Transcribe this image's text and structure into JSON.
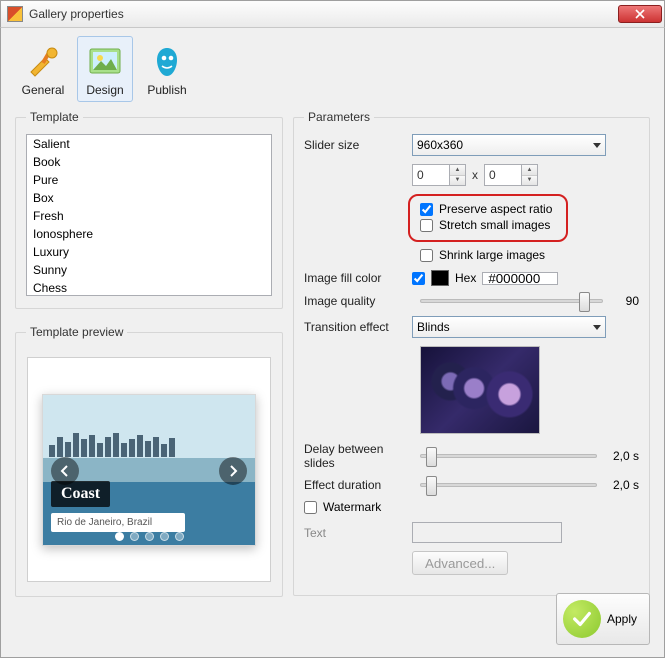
{
  "window": {
    "title": "Gallery properties"
  },
  "toolbar": {
    "general": "General",
    "design": "Design",
    "publish": "Publish"
  },
  "template": {
    "legend": "Template",
    "items": [
      "Salient",
      "Book",
      "Pure",
      "Box",
      "Fresh",
      "Ionosphere",
      "Luxury",
      "Sunny",
      "Chess"
    ]
  },
  "preview": {
    "legend": "Template preview",
    "badge": "Coast",
    "caption": "Rio de Janeiro, Brazil"
  },
  "params": {
    "legend": "Parameters",
    "slider_size_label": "Slider size",
    "slider_size_value": "960x360",
    "width_value": "0",
    "height_value": "0",
    "preserve_label": "Preserve aspect ratio",
    "stretch_label": "Stretch small images",
    "shrink_label": "Shrink large images",
    "fill_color_label": "Image fill color",
    "hex_label": "Hex",
    "hex_value": "#000000",
    "quality_label": "Image quality",
    "quality_value": "90",
    "transition_label": "Transition effect",
    "transition_value": "Blinds",
    "delay_label": "Delay between slides",
    "delay_value": "2,0 s",
    "duration_label": "Effect duration",
    "duration_value": "2,0 s",
    "watermark_label": "Watermark",
    "text_label": "Text",
    "advanced_label": "Advanced..."
  },
  "actions": {
    "apply": "Apply"
  }
}
